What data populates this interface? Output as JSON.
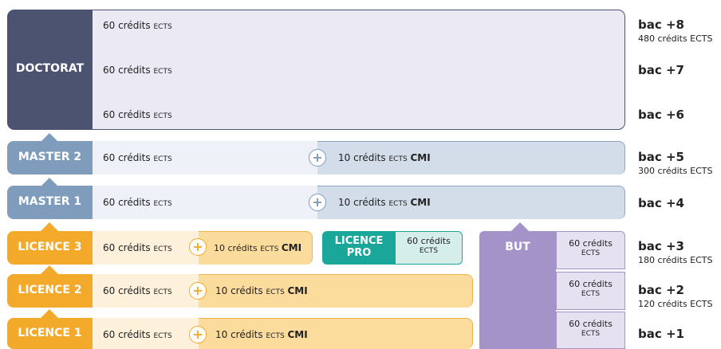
{
  "doctorat": {
    "label": "DOCTORAT",
    "rows": [
      {
        "credits": "60 crédits",
        "ects": "ECTS"
      },
      {
        "credits": "60 crédits",
        "ects": "ECTS"
      },
      {
        "credits": "60 crédits",
        "ects": "ECTS"
      }
    ]
  },
  "master2": {
    "label": "MASTER 2",
    "credits": "60 crédits",
    "ects": "ECTS",
    "cmi_credits": "10 crédits",
    "cmi_ects": "ECTS",
    "cmi": "CMI"
  },
  "master1": {
    "label": "MASTER 1",
    "credits": "60 crédits",
    "ects": "ECTS",
    "cmi_credits": "10 crédits",
    "cmi_ects": "ECTS",
    "cmi": "CMI"
  },
  "licence3": {
    "label": "LICENCE 3",
    "credits": "60 crédits",
    "ects": "ECTS",
    "cmi_credits": "10 crédits",
    "cmi_ects": "ECTS",
    "cmi": "CMI"
  },
  "licence2": {
    "label": "LICENCE 2",
    "credits": "60 crédits",
    "ects": "ECTS",
    "cmi_credits": "10 crédits",
    "cmi_ects": "ECTS",
    "cmi": "CMI"
  },
  "licence1": {
    "label": "LICENCE 1",
    "credits": "60 crédits",
    "ects": "ECTS",
    "cmi_credits": "10 crédits",
    "cmi_ects": "ECTS",
    "cmi": "CMI"
  },
  "licence_pro": {
    "label_line1": "LICENCE",
    "label_line2": "PRO",
    "credits": "60 crédits",
    "ects": "ECTS"
  },
  "but": {
    "label": "BUT",
    "cells": [
      {
        "credits": "60 crédits",
        "ects": "ECTS"
      },
      {
        "credits": "60 crédits",
        "ects": "ECTS"
      },
      {
        "credits": "60 crédits",
        "ects": "ECTS"
      }
    ]
  },
  "plus_symbol": "+",
  "levels": [
    {
      "label": "bac +8",
      "sub": "480 crédits ECTS"
    },
    {
      "label": "bac +7",
      "sub": ""
    },
    {
      "label": "bac +6",
      "sub": ""
    },
    {
      "label": "bac +5",
      "sub": "300 crédits ECTS"
    },
    {
      "label": "bac +4",
      "sub": ""
    },
    {
      "label": "bac +3",
      "sub": "180 crédits ECTS"
    },
    {
      "label": "bac +2",
      "sub": "120 crédits ECTS"
    },
    {
      "label": "bac +1",
      "sub": ""
    }
  ],
  "colors": {
    "doctorat": "#4b5371",
    "master": "#7f9cbd",
    "licence": "#f3a92a",
    "licence_pro": "#1aa79a",
    "but": "#a393c8"
  }
}
